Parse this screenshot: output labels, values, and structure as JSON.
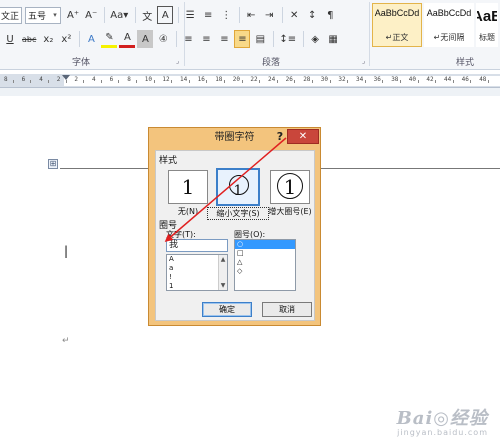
{
  "ribbon": {
    "font_name": "文正",
    "font_size": "五号",
    "font_group_label": "字体",
    "paragraph_group_label": "段落",
    "styles_group_label": "样式",
    "row1_buttons": [
      "A⁺",
      "A⁻",
      "Aa▾",
      "文",
      "A"
    ],
    "row2_buttons": [
      "U",
      "abc",
      "x₂",
      "x²",
      "A",
      "✎",
      "A",
      "A",
      "④"
    ],
    "styles": [
      {
        "preview": "AaBbCcDd",
        "name": "↵正文"
      },
      {
        "preview": "AaBbCcDd",
        "name": "↵无间隔"
      },
      {
        "preview": "AaB",
        "name": "标题"
      }
    ],
    "accent_color": "#e3b44a"
  },
  "ruler": {
    "numbers": [
      "8",
      "6",
      "4",
      "2",
      "2",
      "4",
      "6",
      "8",
      "10",
      "12",
      "14",
      "16",
      "18",
      "20",
      "22",
      "24",
      "26",
      "28",
      "30",
      "32",
      "34",
      "36",
      "38",
      "40",
      "42",
      "44",
      "46",
      "48"
    ]
  },
  "document": {
    "cursor_char": "|",
    "para_mark": "↵",
    "anchor_glyph": "⊞"
  },
  "dialog": {
    "title": "带圈字符",
    "help": "?",
    "close": "✕",
    "style_section": "样式",
    "style_options": [
      {
        "glyph": "1",
        "label": "无(N)"
      },
      {
        "glyph": "1",
        "label": "缩小文字(S)"
      },
      {
        "glyph": "1",
        "label": "增大圈号(E)"
      }
    ],
    "circle_section": "圈号",
    "text_label": "文字(T):",
    "text_value": "我",
    "text_list": [
      "A",
      "a",
      "!",
      "1"
    ],
    "enclosure_label": "圈号(O):",
    "enclosure_list": [
      "○",
      "□",
      "△",
      "◇"
    ],
    "ok_label": "确定",
    "cancel_label": "取消"
  },
  "watermark": {
    "line1": "Bai◎经验",
    "line2": "jingyan.baidu.com"
  },
  "annotation_color": "#e02020"
}
